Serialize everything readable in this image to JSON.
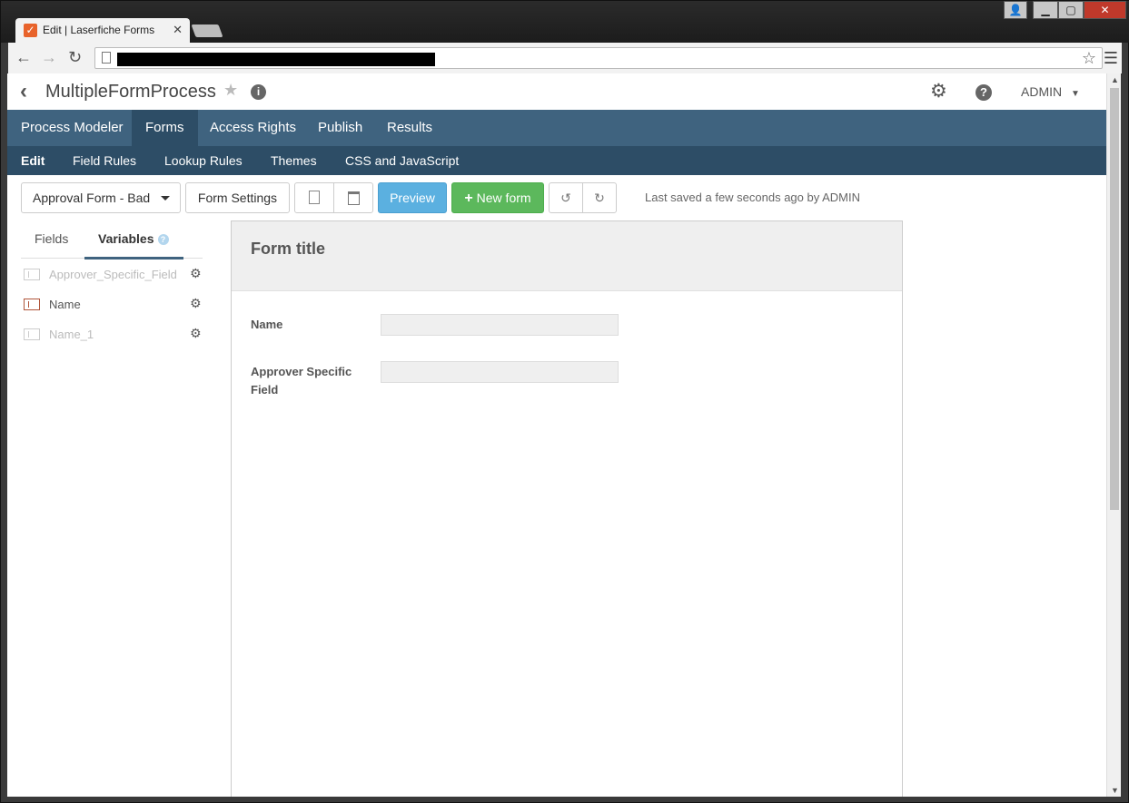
{
  "browser": {
    "tab_title": "Edit | Laserfiche Forms",
    "favicon": "checkmark-icon",
    "tab_close": "✕",
    "window_controls": [
      "user-icon",
      "minimize-icon",
      "maximize-icon",
      "close-icon"
    ]
  },
  "header": {
    "process_title": "MultipleFormProcess",
    "user": "ADMIN"
  },
  "main_nav": {
    "items": [
      "Process Modeler",
      "Forms",
      "Access Rights",
      "Publish",
      "Results"
    ],
    "active": "Forms"
  },
  "sub_nav": {
    "items": [
      "Edit",
      "Field Rules",
      "Lookup Rules",
      "Themes",
      "CSS and JavaScript"
    ],
    "active": "Edit"
  },
  "toolbar": {
    "form_select": "Approval Form - Bad",
    "form_settings": "Form Settings",
    "preview": "Preview",
    "new_form": "New form",
    "new_form_prefix": "+",
    "last_saved": "Last saved a few seconds ago by ADMIN"
  },
  "sidebar": {
    "tabs": [
      "Fields",
      "Variables"
    ],
    "active_tab": "Variables",
    "variables": [
      {
        "label": "Approver_Specific_Field",
        "active": false
      },
      {
        "label": "Name",
        "active": true
      },
      {
        "label": "Name_1",
        "active": false
      }
    ]
  },
  "form": {
    "title": "Form title",
    "fields": [
      {
        "label": "Name",
        "value": ""
      },
      {
        "label": "Approver Specific Field",
        "value": ""
      }
    ]
  },
  "colors": {
    "nav_primary": "#3f637f",
    "nav_secondary": "#2d4d66",
    "preview_btn": "#5bb0e0",
    "new_form_btn": "#5cb85c"
  }
}
